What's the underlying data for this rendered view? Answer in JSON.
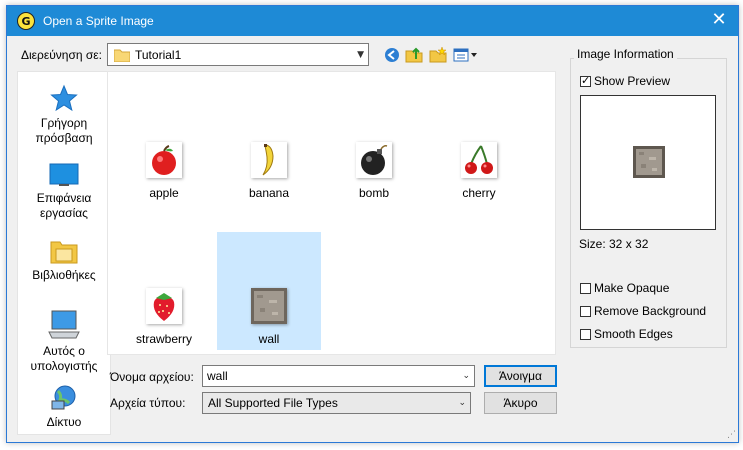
{
  "window": {
    "title": "Open a Sprite Image",
    "app_icon_letter": "G"
  },
  "location": {
    "label": "Διερεύνηση σε:",
    "folder": "Tutorial1"
  },
  "toolbar": {
    "icons": [
      "back-icon",
      "up-folder-icon",
      "new-folder-icon",
      "view-menu-icon"
    ]
  },
  "places": [
    {
      "label": "Γρήγορη πρόσβαση",
      "icon": "star-icon"
    },
    {
      "label": "Επιφάνεια εργασίας",
      "icon": "desktop-icon"
    },
    {
      "label": "Βιβλιοθήκες",
      "icon": "libraries-icon"
    },
    {
      "label": "Αυτός ο υπολογιστής",
      "icon": "computer-icon"
    },
    {
      "label": "Δίκτυο",
      "icon": "network-icon"
    }
  ],
  "files": [
    {
      "name": "apple",
      "icon": "apple-icon",
      "selected": false
    },
    {
      "name": "banana",
      "icon": "banana-icon",
      "selected": false
    },
    {
      "name": "bomb",
      "icon": "bomb-icon",
      "selected": false
    },
    {
      "name": "cherry",
      "icon": "cherry-icon",
      "selected": false
    },
    {
      "name": "strawberry",
      "icon": "strawberry-icon",
      "selected": false
    },
    {
      "name": "wall",
      "icon": "wall-icon",
      "selected": true
    }
  ],
  "filename": {
    "label": "Όνομα αρχείου:",
    "value": "wall"
  },
  "filetype": {
    "label": "Αρχεία τύπου:",
    "value": "All Supported File Types"
  },
  "buttons": {
    "open": "Άνοιγμα",
    "cancel": "Άκυρο"
  },
  "info": {
    "title": "Image Information",
    "show_preview": {
      "label": "Show Preview",
      "checked": true
    },
    "size_text": "Size: 32 x 32",
    "options": [
      {
        "label": "Make Opaque",
        "checked": false
      },
      {
        "label": "Remove Background",
        "checked": false
      },
      {
        "label": "Smooth Edges",
        "checked": false
      }
    ]
  },
  "colors": {
    "titlebar": "#1e8ad6",
    "selection": "#cce8ff",
    "accent": "#0078d7"
  }
}
